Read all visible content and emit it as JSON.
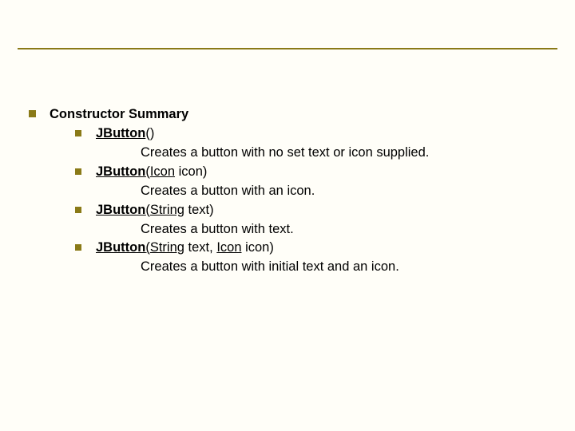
{
  "heading": "Constructor Summary",
  "items": [
    {
      "sig": {
        "name": "JButton",
        "open": "(",
        "close": ")",
        "params": []
      },
      "desc": "Creates a button with no set text or icon supplied."
    },
    {
      "sig": {
        "name": "JButton",
        "open": "(",
        "close": ")",
        "params": [
          {
            "type": "Icon",
            "space": " ",
            "var": "icon"
          }
        ]
      },
      "desc": "Creates a button with an icon."
    },
    {
      "sig": {
        "name": "JButton",
        "open": "(",
        "close": ")",
        "params": [
          {
            "type": "String",
            "space": " ",
            "var": "text"
          }
        ]
      },
      "desc": "Creates a button with text."
    },
    {
      "sig": {
        "name": "JButton",
        "open": "(",
        "close": ")",
        "params": [
          {
            "type": "String",
            "space": " ",
            "var": "text"
          },
          {
            "sep": ", ",
            "type": "Icon",
            "space": " ",
            "var": "icon"
          }
        ]
      },
      "desc": "Creates a button with initial text and an icon."
    }
  ]
}
